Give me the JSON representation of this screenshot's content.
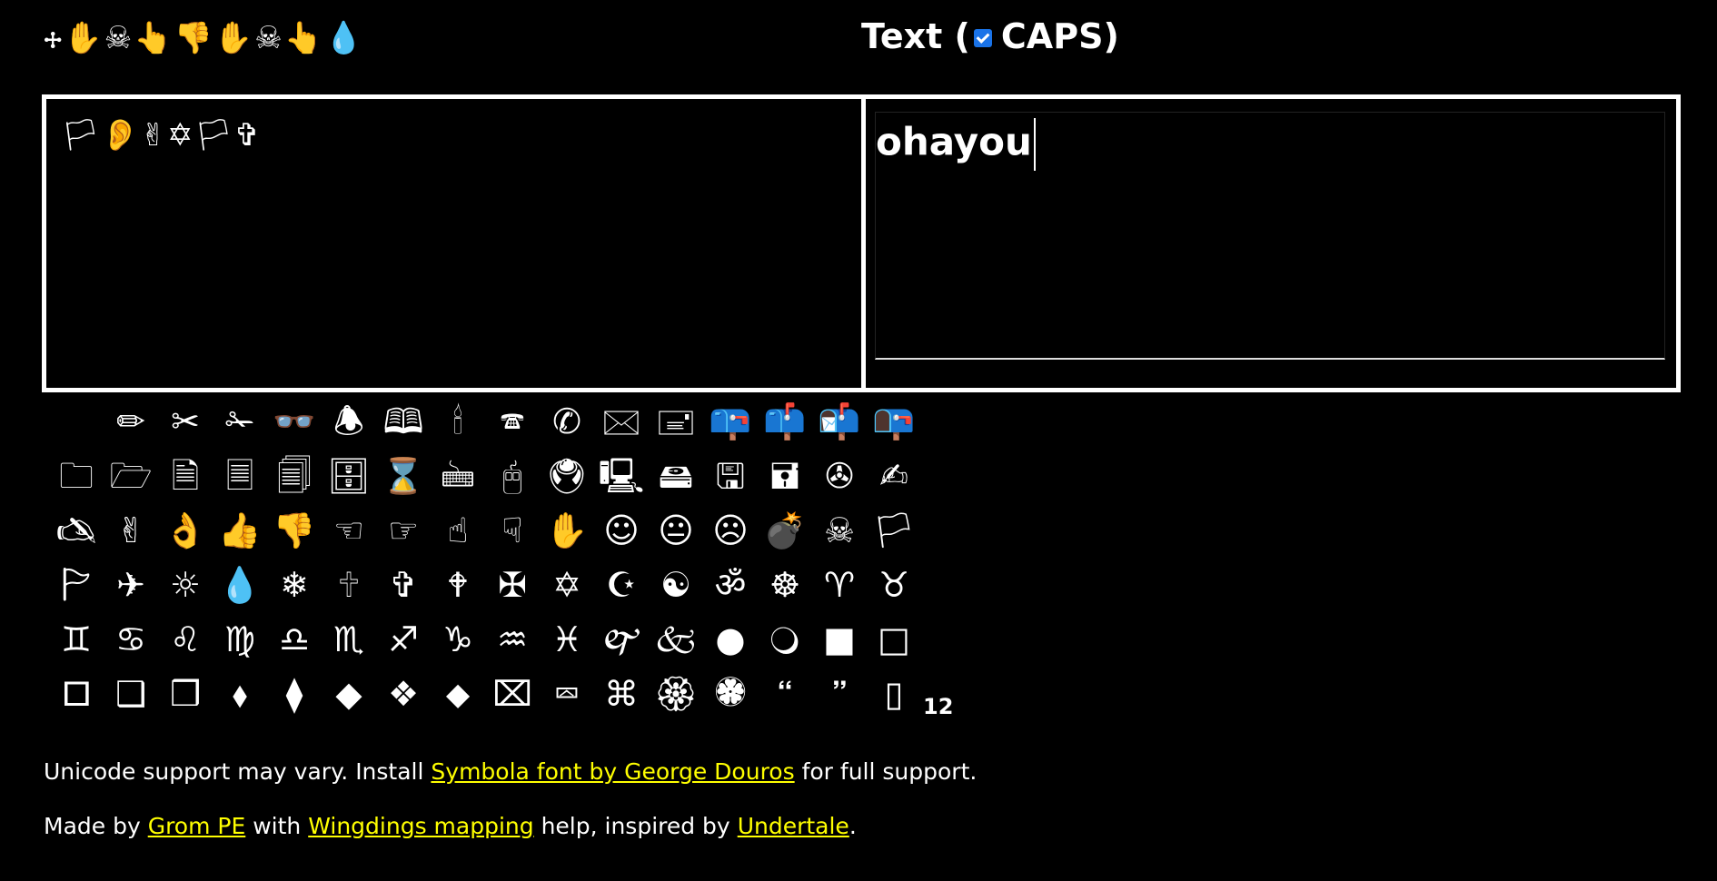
{
  "header": {
    "wingdings_title": "🕂✋☠👆👎✋☠👆💧",
    "title_prefix": "Text (",
    "title_suffix": "CAPS)",
    "caps_checked": true
  },
  "output": {
    "text": "🏳👂✌✡🏳✞"
  },
  "input": {
    "value": "ohayou"
  },
  "glyph_rows": [
    [
      " ",
      "✏",
      "✂",
      "✁",
      "👓",
      "🕭",
      "🕮",
      "🕯",
      "🕿",
      "✆",
      "🖂",
      "🖃",
      "📪",
      "📫",
      "📬",
      "📭"
    ],
    [
      "🗀",
      "🗁",
      "🗎",
      "🗏",
      "🗐",
      "🗄",
      "⌛",
      "🖮",
      "🖰",
      "🖲",
      "🖳",
      "🖴",
      "🖫",
      "🖬",
      "✇",
      "✍"
    ],
    [
      "🖎",
      "✌",
      "👌",
      "👍",
      "👎",
      "☜",
      "☞",
      "☝",
      "☟",
      "✋",
      "☺",
      "😐",
      "☹",
      "💣",
      "☠",
      "🏳"
    ],
    [
      "🏱",
      "✈",
      "☼",
      "💧",
      "❄",
      "🕆",
      "✞",
      "🕈",
      "✠",
      "✡",
      "☪",
      "☯",
      "ॐ",
      "☸",
      "♈",
      "♉"
    ],
    [
      "♊",
      "♋",
      "♌",
      "♍",
      "♎",
      "♏",
      "♐",
      "♑",
      "♒",
      "♓",
      "🙰",
      "🙵",
      "●",
      "🔾",
      "■",
      "□"
    ],
    [
      "🞐",
      "❑",
      "❒",
      "⬧",
      "⧫",
      "◆",
      "❖",
      "⬥",
      "⌧",
      "⮹",
      "⌘",
      "🏵",
      "🏶",
      "🙶",
      "🙷",
      "▯"
    ]
  ],
  "glyph_count": "12",
  "footer": {
    "line1_before": "Unicode support may vary. Install ",
    "line1_link": "Symbola font by George Douros",
    "line1_after": " for full support.",
    "line2_before": "Made by ",
    "line2_link1": "Grom PE",
    "line2_mid1": " with ",
    "line2_link2": "Wingdings mapping",
    "line2_mid2": " help, inspired by ",
    "line2_link3": "Undertale",
    "line2_after": "."
  },
  "colors": {
    "background": "#000000",
    "text": "#ffffff",
    "link": "#ffff00",
    "checkbox": "#1a73e8"
  }
}
